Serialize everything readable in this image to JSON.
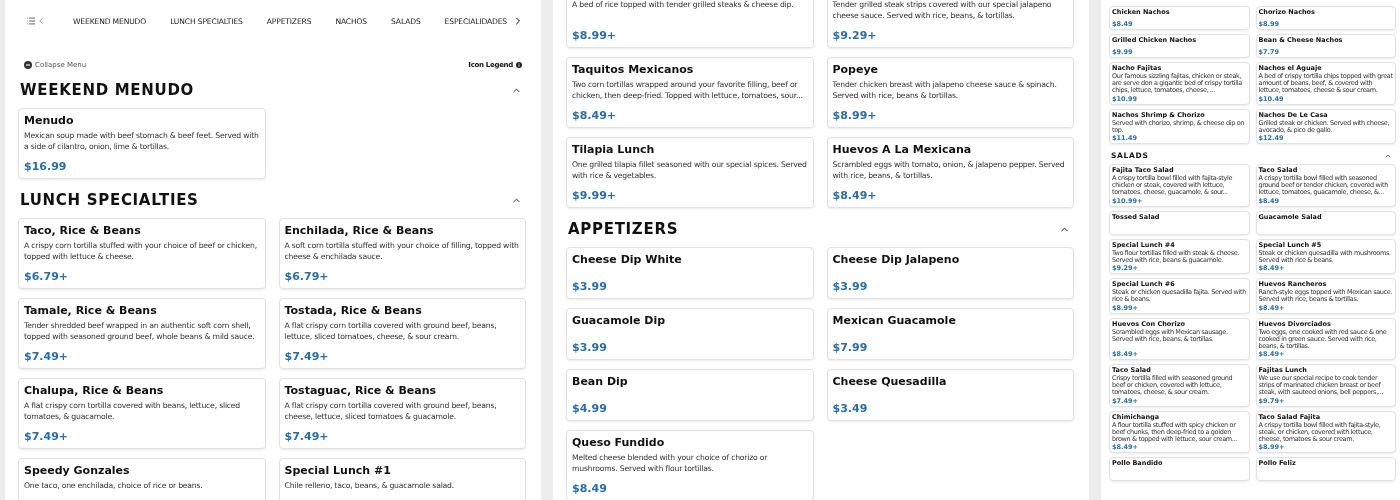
{
  "panels": [
    {
      "kind": "main",
      "nav": {
        "items": [
          {
            "label": "WEEKEND MENUDO"
          },
          {
            "label": "LUNCH SPECIALTIES"
          },
          {
            "label": "APPETIZERS"
          },
          {
            "label": "NACHOS"
          },
          {
            "label": "SALADS"
          },
          {
            "label": "ESPECIALIDADES"
          }
        ]
      },
      "toolbar": {
        "collapse_label": "Collapse Menu",
        "legend_label": "Icon Legend"
      },
      "sections": [
        {
          "title": "WEEKEND MENUDO",
          "expanded": true,
          "items": [
            {
              "name": "Menudo",
              "description": "Mexican soup made with beef stomach & beef feet. Served with a side of cilantro, onion, lime & tortillas.",
              "price": "$16.99"
            }
          ]
        },
        {
          "title": "LUNCH SPECIALTIES",
          "expanded": true,
          "items": [
            {
              "name": "Taco, Rice & Beans",
              "description": "A crispy corn tortilla stuffed with your choice of beef or chicken, topped with lettuce & cheese.",
              "price": "$6.79+"
            },
            {
              "name": "Enchilada, Rice & Beans",
              "description": "A soft corn tortilla stuffed with your choice of filling, topped with cheese & enchilada sauce.",
              "price": "$6.79+"
            },
            {
              "name": "Tamale, Rice & Beans",
              "description": "Tender shredded beef wrapped in an authentic soft corn shell, topped with seasoned ground beef, whole beans & mild sauce.",
              "price": "$7.49+"
            },
            {
              "name": "Tostada, Rice & Beans",
              "description": "A flat crispy corn tortilla covered with ground beef, beans, lettuce, sliced tomatoes, cheese, & sour cream.",
              "price": "$7.49+"
            },
            {
              "name": "Chalupa, Rice & Beans",
              "description": "A flat crispy corn tortilla covered with beans, lettuce, sliced tomatoes, & guacamole.",
              "price": "$7.49+"
            },
            {
              "name": "Tostaguac, Rice & Beans",
              "description": "A flat crispy corn tortilla covered with ground beef, beans, cheese, lettuce, sliced tomatoes & guacamole.",
              "price": "$7.49+"
            },
            {
              "name": "Speedy Gonzales",
              "description": "One taco, one enchilada, choice of rice or beans."
            },
            {
              "name": "Special Lunch #1",
              "description": "Chile relleno, taco, beans, & guacamole salad."
            }
          ]
        }
      ]
    },
    {
      "kind": "main",
      "sections": [
        {
          "items": [
            {
              "description": "A bed of rice topped with tender grilled steaks & cheese dip.",
              "price": "$8.99+"
            },
            {
              "description": "Tender grilled steak strips covered with our special jalapeno cheese sauce. Served with rice, beans, & tortillas.",
              "price": "$9.29+"
            },
            {
              "name": "Taquitos Mexicanos",
              "description": "Two corn tortillas wrapped around your favorite filling, beef or chicken, then deep-fried. Topped with lettuce, tomatoes, sour...",
              "price": "$8.49+"
            },
            {
              "name": "Popeye",
              "description": "Tender chicken breast with jalapeno cheese sauce & spinach. Served with rice, beans & tortillas.",
              "price": "$8.99+"
            },
            {
              "name": "Tilapia Lunch",
              "description": "One grilled tilapia fillet seasoned with our special spices. Served with rice & vegetables.",
              "price": "$9.99+"
            },
            {
              "name": "Huevos A La Mexicana",
              "description": "Scrambled eggs with tomato, onion, & jalapeno pepper. Served with rice, beans, & tortillas.",
              "price": "$8.49+"
            }
          ]
        },
        {
          "title": "APPETIZERS",
          "expanded": true,
          "items": [
            {
              "name": "Cheese Dip White",
              "price": "$3.99"
            },
            {
              "name": "Cheese Dip Jalapeno",
              "price": "$3.99"
            },
            {
              "name": "Guacamole Dip",
              "price": "$3.99"
            },
            {
              "name": "Mexican Guacamole",
              "price": "$7.99"
            },
            {
              "name": "Bean Dip",
              "price": "$4.99"
            },
            {
              "name": "Cheese Quesadilla",
              "price": "$3.49"
            },
            {
              "name": "Queso Fundido",
              "description": "Melted cheese blended with your choice of chorizo or mushrooms. Served with flour tortillas.",
              "price": "$8.49"
            }
          ]
        }
      ]
    },
    {
      "kind": "mini",
      "sections": [
        {
          "items": [
            {
              "name": "Chicken Nachos",
              "price": "$8.49"
            },
            {
              "name": "Chorizo Nachos",
              "price": "$8.99"
            },
            {
              "name": "Grilled Chicken Nachos",
              "price": "$9.99"
            },
            {
              "name": "Bean & Cheese Nachos",
              "price": "$7.79"
            },
            {
              "name": "Nacho Fajitas",
              "description": "Our famous sizzling fajitas, chicken or steak, are serve don a gigantic bed of crispy tortilla chips, lettuce, tomatoes, cheese, ...",
              "price": "$10.99"
            },
            {
              "name": "Nachos el Aguaje",
              "description": "A bed of crispy tortilla chips topped with great amount of beans, beef, & covered with lettuce, tomatoes, cheese & sour cream.",
              "price": "$10.49"
            },
            {
              "name": "Nachos Shrimp & Chorizo",
              "description": "Served with chorizo, shrimp, & cheese dip on top.",
              "price": "$11.49"
            },
            {
              "name": "Nachos De Le Casa",
              "description": "Grilled steak or chicken. Served with cheese, avocado, & pico de gallo.",
              "price": "$12.49"
            }
          ]
        },
        {
          "title": "SALADS",
          "expanded": true,
          "items": [
            {
              "name": "Fajita Taco Salad",
              "description": "A crispy tortilla bowl filled with fajita-style chicken or steak, covered with lettuce, tomatoes, cheese, guacamole, & sour...",
              "price": "$10.99+"
            },
            {
              "name": "Taco Salad",
              "description": "A crispy tortilla bowl filled with seasoned ground beef or tender chicken, covered with lettuce, tomatoes, guacamole, cheese, &...",
              "price": "$8.49"
            },
            {
              "name": "Tossed Salad"
            },
            {
              "name": "Guacamole Salad"
            },
            {
              "name": "Special Lunch #4",
              "description": "Two flour tortillas filled with steak & cheese. Served with rice, beans & guacamole.",
              "price": "$9.29+"
            },
            {
              "name": "Special Lunch #5",
              "description": "Steak or chicken quesadilla with mushrooms. Served with rice & beans.",
              "price": "$8.49+"
            },
            {
              "name": "Special Lunch #6",
              "description": "Steak or chicken quesadilla fajita. Served with rice & beans.",
              "price": "$8.99+"
            },
            {
              "name": "Huevos Rancheros",
              "description": "Ranch-style eggs topped with Mexican sauce. Served with rice, beans & tortillas.",
              "price": "$8.49+"
            },
            {
              "name": "Huevos Con Chorizo",
              "description": "Scrambled eggs with Mexican sausage. Served with rice, beans, & tortillas.",
              "price": "$8.49+"
            },
            {
              "name": "Huevos Divorciados",
              "description": "Two eggs, one cooked with red sauce & one cooked in green sauce. Served with rice, beans, & tortillas.",
              "price": "$8.49+"
            },
            {
              "name": "Taco Salad",
              "description": "Crispy tortilla filled with seasoned ground beef or chicken, covered with lettuce, tomatoes, cheese, & sour cream.",
              "price": "$7.49+"
            },
            {
              "name": "Fajitas Lunch",
              "description": "We use our special recipe to cook tender strips of marinated chicken breast or beef steak, with sauteed onions, bell peppers,...",
              "price": "$9.79+"
            },
            {
              "name": "Chimichanga",
              "description": "A flour tortilla stuffed with spicy chicken or beef chunks, then deep-fried to a golden brown & topped with lettuce, sour cream...",
              "price": "$8.49+"
            },
            {
              "name": "Taco Salad Fajita",
              "description": "A crispy tortilla bowl filled with fajita-style, steak, or chicken, covered with lettuce, cheese, tomatoes & sour cream.",
              "price": "$8.99+"
            },
            {
              "name": "Pollo Bandido"
            },
            {
              "name": "Pollo Feliz"
            }
          ]
        }
      ]
    }
  ]
}
